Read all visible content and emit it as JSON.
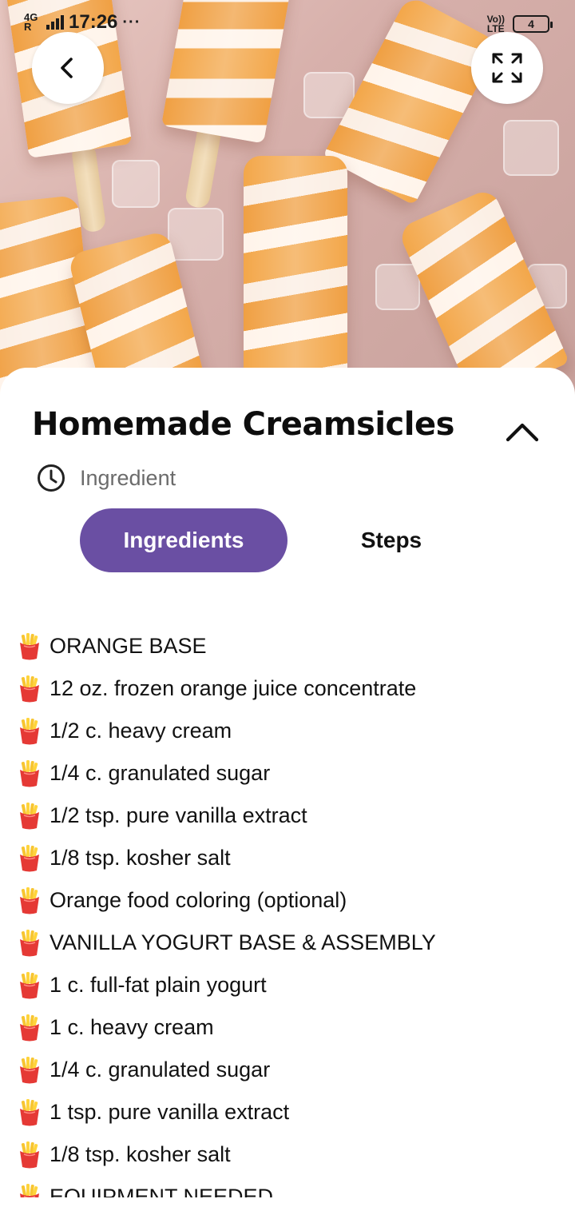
{
  "status_bar": {
    "network": "4G",
    "roaming": "R",
    "time": "17:26",
    "more": "···",
    "volte_line1": "Vo))",
    "volte_line2": "LTE",
    "battery": "4"
  },
  "recipe": {
    "title": "Homemade Creamsicles",
    "meta_label": "Ingredient"
  },
  "tabs": [
    {
      "label": "Ingredients",
      "active": true
    },
    {
      "label": "Steps",
      "active": false
    }
  ],
  "ingredients": [
    "ORANGE BASE",
    "12 oz. frozen orange juice concentrate",
    "1/2 c. heavy cream",
    "1/4 c. granulated sugar",
    "1/2 tsp. pure vanilla extract",
    "1/8 tsp. kosher salt",
    "Orange food coloring (optional)",
    "VANILLA YOGURT BASE & ASSEMBLY",
    "1 c. full-fat plain yogurt",
    "1 c. heavy cream",
    "1/4 c. granulated sugar",
    "1 tsp. pure vanilla extract",
    "1/8 tsp. kosher salt",
    "EQUIPMENT NEEDED"
  ],
  "icons": {
    "back": "chevron-left-icon",
    "fullscreen": "expand-icon",
    "collapse": "chevron-up-icon",
    "meta": "clock-icon",
    "bullet": "french-fries-icon"
  },
  "colors": {
    "accent": "#6a4fa3",
    "title": "#0d0d0d",
    "meta": "#6b6b6b"
  }
}
